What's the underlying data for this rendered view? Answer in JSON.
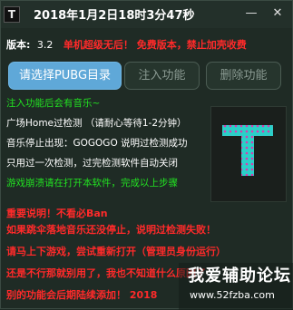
{
  "window": {
    "icon_letter": "T",
    "title": "2018年1月2日18时3分47秒",
    "minimize_glyph": "—",
    "close_glyph": "✕"
  },
  "info": {
    "version_label": "版本:",
    "version_value": "3.2",
    "notice": "单机超级无后！  免费版本，禁止加壳收费"
  },
  "buttons": {
    "select_label": "请选择PUBG目录",
    "inject_label": "注入功能",
    "delete_label": "删除功能"
  },
  "log": {
    "lines": [
      "注入功能后会有音乐~",
      "广场Home过检测 （请耐心等待1-2分钟）",
      "音乐停止出现：GOGOGO  说明过检测成功",
      "只用过一次检测，过完检测软件自动关闭",
      "游戏崩溃请在打开本软件，完成以上步骤"
    ]
  },
  "banner": "重要说明！不看必Ban",
  "warnings": [
    "如果跳伞落地音乐还没停止，说明过检测失败！",
    "请马上下游戏，尝试重新打开（管理员身份运行）",
    "还是不行那就别用了，我也不知道什么原因了",
    "别的功能会后期陆续添加！  2018"
  ],
  "watermark": {
    "title": "我爱辅助论坛",
    "url": "www.52fzba.com"
  },
  "colors": {
    "accent_button": "#5fa8d8",
    "log_green": "#22e022",
    "warning_red": "#ff2a2a"
  }
}
